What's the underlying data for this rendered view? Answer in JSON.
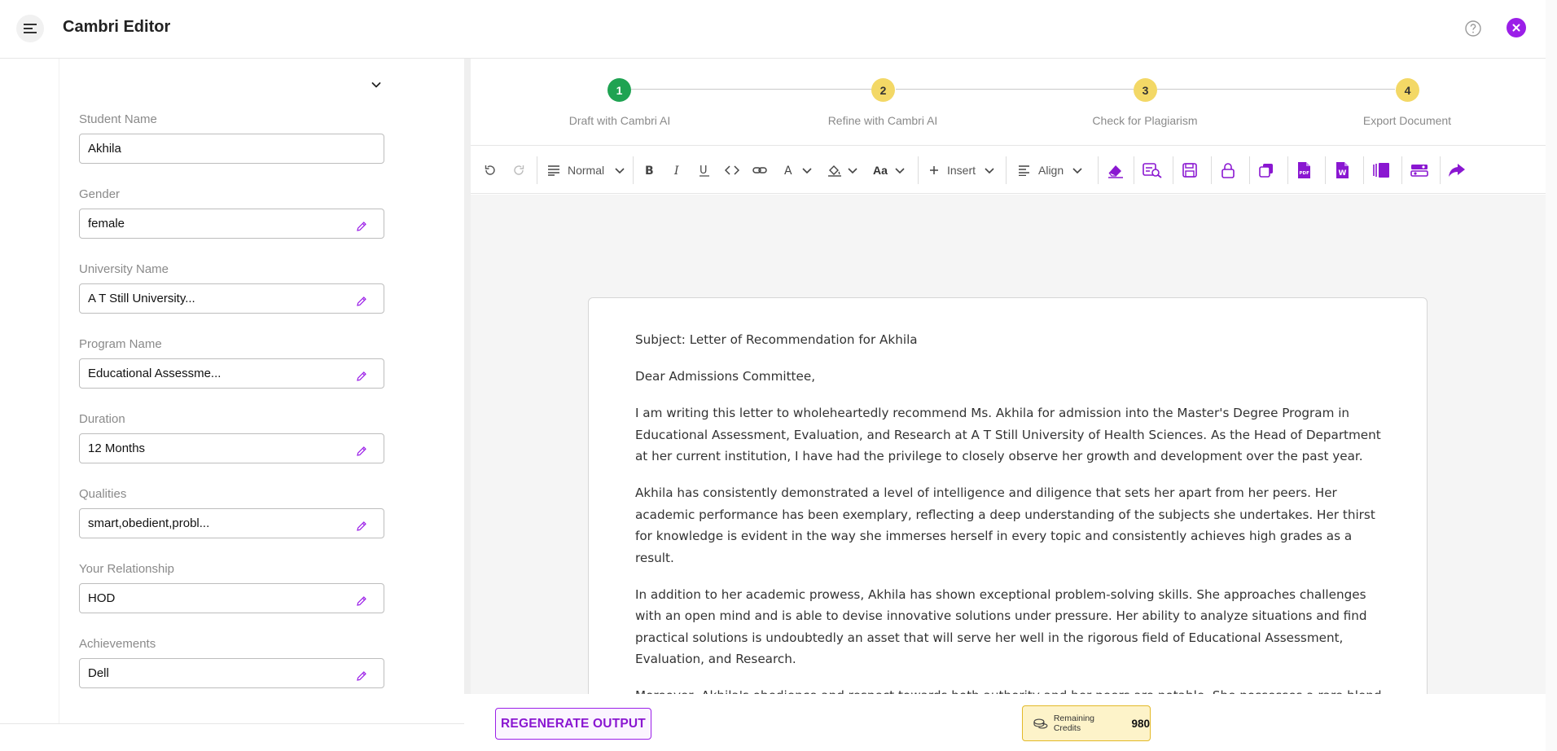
{
  "header": {
    "title": "Cambri Editor",
    "menu_icon": "menu-icon",
    "help_icon": "help-circle-icon",
    "close_icon": "close-icon"
  },
  "form": {
    "fields": [
      {
        "label": "Student Name",
        "value": "Akhila",
        "editable_icon": false
      },
      {
        "label": "Gender",
        "value": "female",
        "editable_icon": true
      },
      {
        "label": "University Name",
        "value": "A T Still University...",
        "editable_icon": true
      },
      {
        "label": "Program Name",
        "value": "Educational Assessme...",
        "editable_icon": true
      },
      {
        "label": "Duration",
        "value": "12 Months",
        "editable_icon": true
      },
      {
        "label": "Qualities",
        "value": "smart,obedient,probl...",
        "editable_icon": true
      },
      {
        "label": "Your Relationship",
        "value": "HOD",
        "editable_icon": true
      },
      {
        "label": "Achievements",
        "value": "Dell",
        "editable_icon": true
      }
    ]
  },
  "stepper": {
    "steps": [
      {
        "number": "1",
        "label": "Draft with Cambri AI",
        "status": "done"
      },
      {
        "number": "2",
        "label": "Refine with Cambri AI",
        "status": "todo"
      },
      {
        "number": "3",
        "label": "Check for Plagiarism",
        "status": "todo"
      },
      {
        "number": "4",
        "label": "Export Document",
        "status": "todo"
      }
    ]
  },
  "toolbar": {
    "paragraph_style": "Normal",
    "font_size_label": "Aa",
    "insert_label": "Insert",
    "align_label": "Align"
  },
  "document": {
    "paragraphs": [
      "Subject: Letter of Recommendation for Akhila",
      "Dear Admissions Committee,",
      "I am writing this letter to wholeheartedly recommend Ms. Akhila for admission into the Master's Degree Program in Educational Assessment, Evaluation, and Research at A T Still University of Health Sciences. As the Head of Department at her current institution, I have had the privilege to closely observe her growth and development over the past year.",
      "Akhila has consistently demonstrated a level of intelligence and diligence that sets her apart from her peers. Her academic performance has been exemplary, reflecting a deep understanding of the subjects she undertakes. Her thirst for knowledge is evident in the way she immerses herself in every topic and consistently achieves high grades as a result.",
      "In addition to her academic prowess, Akhila has shown exceptional problem-solving skills. She approaches challenges with an open mind and is able to devise innovative solutions under pressure. Her ability to analyze situations and find practical solutions is undoubtedly an asset that will serve her well in the rigorous field of Educational Assessment, Evaluation, and Research.",
      "Moreover, Akhila's obedience and respect towards both authority and her peers are notable. She possesses a rare blend of humility and assertiveness which ensures she listens attentively to others' viewpoints while also confidently articulating"
    ]
  },
  "bottom": {
    "regenerate_label": "REGENERATE OUTPUT",
    "credits_label": "Remaining Credits",
    "credits_value": "980"
  },
  "colors": {
    "accent": "#9b1fe8",
    "step_done": "#1fa352",
    "step_todo": "#f3d866",
    "credits_bg": "#fdf3c9"
  }
}
